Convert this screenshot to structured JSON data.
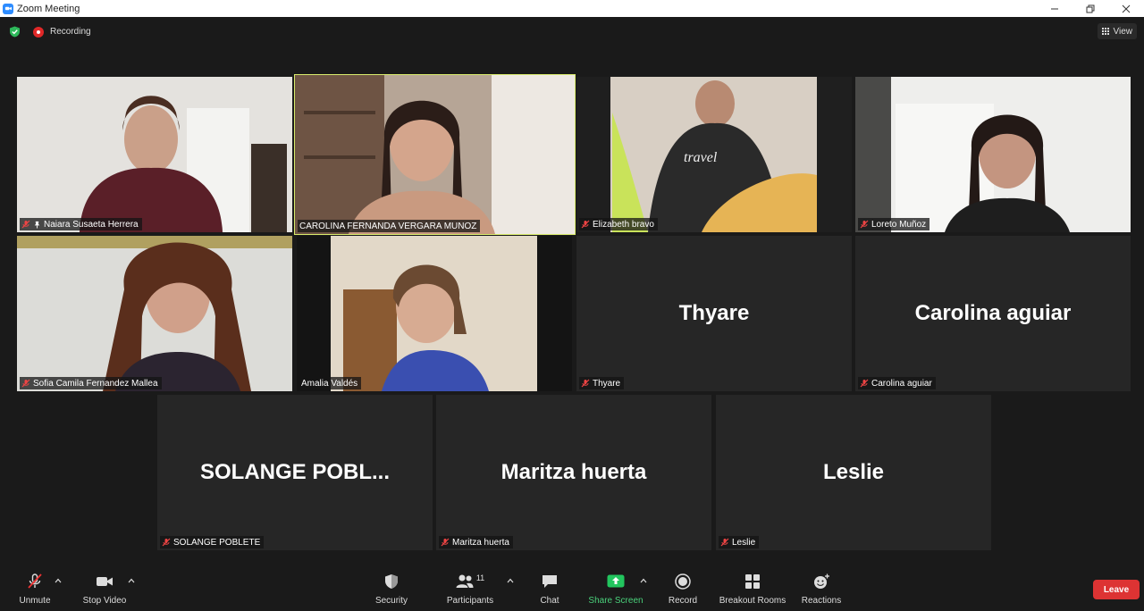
{
  "window": {
    "title": "Zoom Meeting"
  },
  "topbar": {
    "recording_label": "Recording",
    "view_label": "View"
  },
  "participants": [
    {
      "name": "Naiara Susaeta Herrera",
      "video": true,
      "muted": true,
      "pinned": true
    },
    {
      "name": "CAROLINA FERNANDA VERGARA MUNOZ",
      "video": true,
      "muted": false,
      "active_speaker": true
    },
    {
      "name": "Elizabeth bravo",
      "video": true,
      "muted": true
    },
    {
      "name": "Loreto Muñoz",
      "video": true,
      "muted": true
    },
    {
      "name": "Sofia Camila Fernandez Mallea",
      "video": true,
      "muted": true
    },
    {
      "name": "Amalia Valdés",
      "video": true,
      "muted": false
    },
    {
      "name": "Thyare",
      "display": "Thyare",
      "video": false,
      "muted": true
    },
    {
      "name": "Carolina aguiar",
      "display": "Carolina aguiar",
      "video": false,
      "muted": true
    },
    {
      "name": "SOLANGE POBLETE",
      "display": "SOLANGE  POBL...",
      "video": false,
      "muted": true
    },
    {
      "name": "Maritza huerta",
      "display": "Maritza huerta",
      "video": false,
      "muted": true
    },
    {
      "name": "Leslie",
      "display": "Leslie",
      "video": false,
      "muted": true
    }
  ],
  "toolbar": {
    "unmute": "Unmute",
    "stop_video": "Stop Video",
    "security": "Security",
    "participants": "Participants",
    "participants_count": "11",
    "chat": "Chat",
    "share_screen": "Share Screen",
    "record": "Record",
    "breakout_rooms": "Breakout Rooms",
    "reactions": "Reactions",
    "leave": "Leave"
  },
  "colors": {
    "accent_green": "#4ad17b",
    "active_speaker": "#d9ec6c",
    "leave_red": "#dd3333",
    "zoom_blue": "#2d8cff"
  }
}
